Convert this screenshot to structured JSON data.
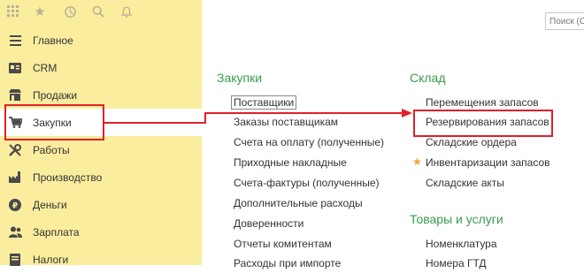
{
  "toolbar": {
    "icons": [
      "apps-grid-icon",
      "star-icon",
      "history-icon",
      "search-icon",
      "bell-icon"
    ]
  },
  "sidebar": {
    "items": [
      {
        "label": "Главное",
        "icon": "menu-icon"
      },
      {
        "label": "CRM",
        "icon": "crm-icon"
      },
      {
        "label": "Продажи",
        "icon": "shop-icon"
      },
      {
        "label": "Закупки",
        "icon": "cart-icon",
        "active": true
      },
      {
        "label": "Работы",
        "icon": "tools-icon"
      },
      {
        "label": "Производство",
        "icon": "factory-icon"
      },
      {
        "label": "Деньги",
        "icon": "money-icon"
      },
      {
        "label": "Зарплата",
        "icon": "people-icon"
      },
      {
        "label": "Налоги",
        "icon": "tax-icon"
      }
    ]
  },
  "search": {
    "placeholder": "Поиск (Ctrl+F)"
  },
  "sections": {
    "zakupki": {
      "title": "Закупки",
      "links": [
        "Поставщики",
        "Заказы поставщикам",
        "Счета на оплату (полученные)",
        "Приходные накладные",
        "Счета-фактуры (полученные)",
        "Дополнительные расходы",
        "Доверенности",
        "Отчеты комитентам",
        "Расходы при импорте"
      ]
    },
    "sklad": {
      "title": "Склад",
      "links": [
        "Перемещения запасов",
        "Резервирования запасов",
        "Складские ордера",
        "Инвентаризации запасов",
        "Складские акты"
      ]
    },
    "tovary": {
      "title": "Товары и услуги",
      "links": [
        "Номенклатура",
        "Номера ГТД"
      ]
    }
  },
  "colors": {
    "sidebar_bg": "#fbed9e",
    "section_title": "#3a9b4c",
    "highlight": "#e0202a",
    "star": "#f0a030"
  }
}
